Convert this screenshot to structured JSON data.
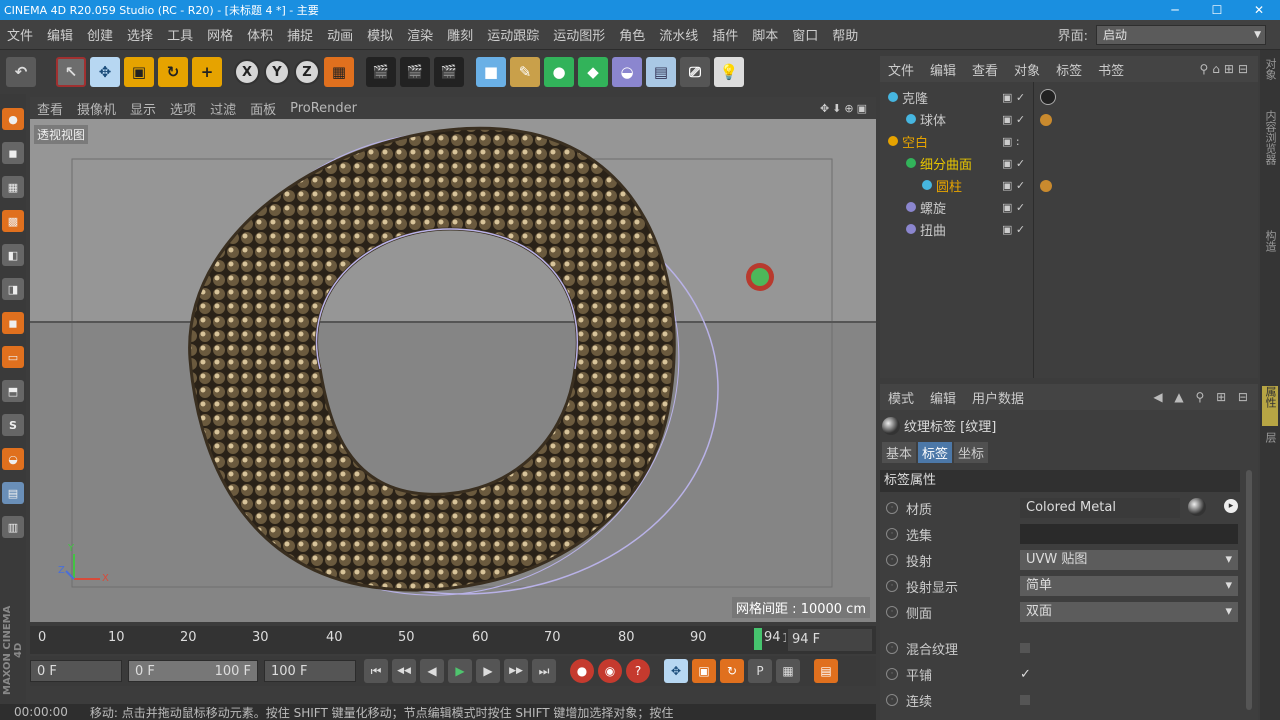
{
  "titlebar": {
    "title": "CINEMA 4D R20.059 Studio (RC - R20) - [未标题 4 *] - 主要",
    "min": "─",
    "max": "☐",
    "close": "✕"
  },
  "menu": {
    "items": [
      "文件",
      "编辑",
      "创建",
      "选择",
      "工具",
      "网格",
      "体积",
      "捕捉",
      "动画",
      "模拟",
      "渲染",
      "雕刻",
      "运动跟踪",
      "运动图形",
      "角色",
      "流水线",
      "插件",
      "脚本",
      "窗口",
      "帮助"
    ],
    "layout_label": "界面:",
    "layout_value": "启动"
  },
  "toolbar": {
    "undo": "↶",
    "select": "↖",
    "move": "✥",
    "scale": "▣",
    "rotate": "↻",
    "add": "+",
    "x": "X",
    "y": "Y",
    "z": "Z",
    "coord": "▦",
    "render1": "🎬",
    "render2": "🎬",
    "render3": "🎬",
    "cube": "■",
    "pen": "✎",
    "green": "●",
    "gen": "◆",
    "deform": "◒",
    "floor": "▤",
    "camera": "⎚",
    "light": "💡"
  },
  "left_tools": [
    "●",
    "◼",
    "▦",
    "▩",
    "◧",
    "◨",
    "◼",
    "▭",
    "⬒",
    "S",
    "◒",
    "▤",
    "▥"
  ],
  "viewport": {
    "menu": [
      "查看",
      "摄像机",
      "显示",
      "选项",
      "过滤",
      "面板",
      "ProRender"
    ],
    "nav_icons": "✥⬇⊕▣",
    "view_name": "透视视图",
    "grid_spacing": "网格间距 : 10000 cm",
    "axis_y": "Y",
    "axis_x": "X",
    "axis_z": "Z"
  },
  "timeline": {
    "ticks": [
      "0",
      "10",
      "20",
      "30",
      "40",
      "50",
      "60",
      "70",
      "80",
      "90"
    ],
    "current": "94",
    "current_tail": "10",
    "frame_field": "94 F"
  },
  "transport": {
    "start_field": "0 F",
    "range_start": "0 F",
    "range_end": "100 F",
    "end_field": "100 F",
    "btn_first": "⏮",
    "btn_prev_key": "◀◀",
    "btn_prev": "◀",
    "btn_play": "▶",
    "btn_next": "▶",
    "btn_next_key": "▶▶",
    "btn_last": "⏭",
    "rec1": "●",
    "rec2": "◉",
    "rec3": "?",
    "k1": "✥",
    "k2": "▣",
    "k3": "↻",
    "k4": "P",
    "k5": "▦",
    "k6": "▤"
  },
  "statusbar": {
    "time": "00:00:00",
    "message": "移动: 点击并拖动鼠标移动元素。按住 SHIFT 键量化移动；节点编辑模式时按住 SHIFT 键增加选择对象；按住"
  },
  "objects_panel": {
    "menu": [
      "文件",
      "编辑",
      "查看",
      "对象",
      "标签",
      "书签"
    ],
    "icons": "⚲⌂⊞⊟",
    "rows": [
      {
        "name": "克隆",
        "color": "#46b6e0",
        "tags": "ball",
        "indent": 2,
        "flags": "▣ ✓"
      },
      {
        "name": "球体",
        "color": "#46b6e0",
        "tags": "small",
        "indent": 18,
        "flags": "▣ ✓"
      },
      {
        "name": "空白",
        "color": "#e6a300",
        "tags": "",
        "indent": 2,
        "flags": "▣ :"
      },
      {
        "name": "细分曲面",
        "color": "#32b35a",
        "tags": "",
        "indent": 18,
        "flags": "▣ ✓"
      },
      {
        "name": "圆柱",
        "color": "#46b6e0",
        "tags": "small",
        "indent": 34,
        "flags": "▣ ✓"
      },
      {
        "name": "螺旋",
        "color": "#8b86cf",
        "tags": "",
        "indent": 18,
        "flags": "▣ ✓"
      },
      {
        "name": "扭曲",
        "color": "#8b86cf",
        "tags": "",
        "indent": 18,
        "flags": "▣ ✓"
      }
    ]
  },
  "attributes_panel": {
    "menu": [
      "模式",
      "编辑",
      "用户数据"
    ],
    "icons": "◀ ▲ ⚲ ⊞ ⊟",
    "tag_title": "纹理标签 [纹理]",
    "tabs": [
      "基本",
      "标签",
      "坐标"
    ],
    "section": "标签属性",
    "rows": [
      {
        "label": "材质",
        "value": "Colored Metal",
        "kind": "material"
      },
      {
        "label": "选集",
        "value": "",
        "kind": "dark"
      },
      {
        "label": "投射",
        "value": "UVW 贴图",
        "kind": "select"
      },
      {
        "label": "投射显示",
        "value": "简单",
        "kind": "select"
      },
      {
        "label": "侧面",
        "value": "双面",
        "kind": "select"
      },
      {
        "label": "混合纹理",
        "value": "",
        "kind": "box"
      },
      {
        "label": "平铺",
        "value": "✓",
        "kind": "check"
      },
      {
        "label": "连续",
        "value": "",
        "kind": "box"
      }
    ]
  },
  "right_strip": [
    "对象",
    "内容浏览器",
    "构造",
    "属性",
    "层"
  ]
}
